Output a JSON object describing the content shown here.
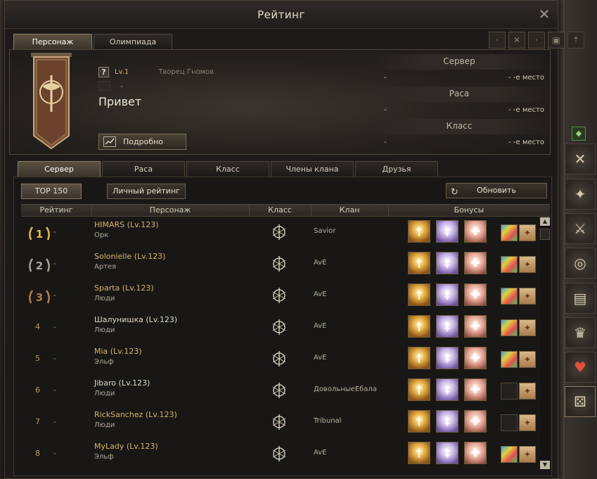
{
  "window": {
    "title": "Рейтинг"
  },
  "top_tabs": [
    {
      "label": "Персонаж",
      "active": true
    },
    {
      "label": "Олимпиада",
      "active": false
    }
  ],
  "character": {
    "level": "Lv.1",
    "creator": "Творец Гномов",
    "clan": "-",
    "name": "Привет",
    "detail_button": "Подробно"
  },
  "ranks": [
    {
      "title": "Сервер",
      "name": "-",
      "place": "- -е место"
    },
    {
      "title": "Раса",
      "name": "-",
      "place": "- -е место"
    },
    {
      "title": "Класс",
      "name": "-",
      "place": "- -е место"
    }
  ],
  "sub_tabs": [
    {
      "label": "Сервер",
      "active": true
    },
    {
      "label": "Раса",
      "active": false
    },
    {
      "label": "Класс",
      "active": false
    },
    {
      "label": "Члены клана",
      "active": false
    },
    {
      "label": "Друзья",
      "active": false
    }
  ],
  "toolbar": {
    "top_label": "TOP 150",
    "personal_label": "Личный рейтинг",
    "refresh_label": "Обновить"
  },
  "table": {
    "headers": [
      "Рейтинг",
      "Персонаж",
      "Класс",
      "Клан",
      "Бонусы"
    ],
    "rows": [
      {
        "rank": "1",
        "change": "-",
        "name": "HIMARS (Lv.123)",
        "race": "Орк",
        "clan": "Savior",
        "gem": true
      },
      {
        "rank": "2",
        "change": "-",
        "name": "Solonielle (Lv.123)",
        "race": "Артея",
        "clan": "AvE",
        "gem": true
      },
      {
        "rank": "3",
        "change": "-",
        "name": "Sparta (Lv.123)",
        "race": "Люди",
        "clan": "AvE",
        "gem": true
      },
      {
        "rank": "4",
        "change": "-",
        "name": "Шалунишка (Lv.123)",
        "race": "Люди",
        "clan": "AvE",
        "gem": true
      },
      {
        "rank": "5",
        "change": "-",
        "name": "Mia (Lv.123)",
        "race": "Эльф",
        "clan": "AvE",
        "gem": true
      },
      {
        "rank": "6",
        "change": "-",
        "name": "Jibaro (Lv.123)",
        "race": "Люди",
        "clan": "ДовольныеЕбала",
        "gem": false
      },
      {
        "rank": "7",
        "change": "-",
        "name": "RickSanchez (Lv.123)",
        "race": "Люди",
        "clan": "Tribunal",
        "gem": false
      },
      {
        "rank": "8",
        "change": "-",
        "name": "MyLady (Lv.123)",
        "race": "Эльф",
        "clan": "AvE",
        "gem": true
      }
    ]
  }
}
